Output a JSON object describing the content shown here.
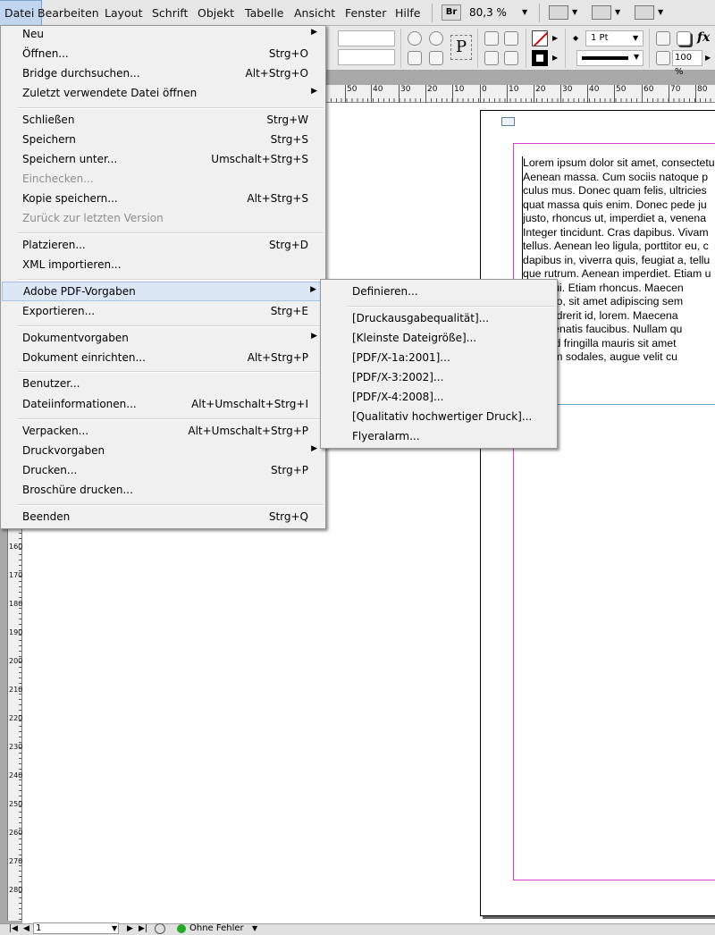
{
  "menubar": {
    "items": [
      "Datei",
      "Bearbeiten",
      "Layout",
      "Schrift",
      "Objekt",
      "Tabelle",
      "Ansicht",
      "Fenster",
      "Hilfe"
    ],
    "bridge_label": "Br",
    "zoom": "80,3 %"
  },
  "control_panel": {
    "stroke_weight": "1 Pt",
    "opacity": "100 %",
    "fx_label": "fx",
    "paragraph_glyph": "P"
  },
  "ruler": {
    "h_labels": [
      "50",
      "40",
      "30",
      "20",
      "10",
      "0",
      "10",
      "20",
      "30",
      "40",
      "50",
      "60",
      "70",
      "80"
    ],
    "v_labels": [
      "160",
      "170",
      "180",
      "190",
      "200",
      "210",
      "220",
      "230",
      "240",
      "250",
      "260",
      "270",
      "280"
    ]
  },
  "document": {
    "body_lines": [
      "Lorem ipsum dolor sit amet, consectetuer",
      "Aenean massa. Cum sociis natoque p",
      "culus mus. Donec quam felis, ultricies",
      "quat massa quis enim. Donec pede ju",
      "justo, rhoncus ut, imperdiet a, venena",
      "Integer tincidunt. Cras dapibus. Vivam",
      "tellus. Aenean leo ligula, porttitor eu, c",
      "dapibus in, viverra quis, feugiat a, tellu",
      "que rutrum. Aenean imperdiet. Etiam u",
      "eget dui. Etiam rhoncus. Maecen",
      "er libero, sit amet adipiscing sem",
      "ar, hendrerit id, lorem. Maecena",
      "ro venenatis faucibus. Nullam qu",
      "eo. Sed fringilla mauris sit amet",
      "bendum sodales, augue velit cu"
    ]
  },
  "file_menu": {
    "items": [
      {
        "label": "Neu",
        "shortcut": "",
        "submenu": true,
        "disabled": false
      },
      {
        "label": "Öffnen...",
        "shortcut": "Strg+O",
        "submenu": false,
        "disabled": false
      },
      {
        "label": "Bridge durchsuchen...",
        "shortcut": "Alt+Strg+O",
        "submenu": false,
        "disabled": false
      },
      {
        "label": "Zuletzt verwendete Datei öffnen",
        "shortcut": "",
        "submenu": true,
        "disabled": false
      },
      {
        "label": "Schließen",
        "shortcut": "Strg+W",
        "submenu": false,
        "disabled": false
      },
      {
        "label": "Speichern",
        "shortcut": "Strg+S",
        "submenu": false,
        "disabled": false
      },
      {
        "label": "Speichern unter...",
        "shortcut": "Umschalt+Strg+S",
        "submenu": false,
        "disabled": false
      },
      {
        "label": "Einchecken...",
        "shortcut": "",
        "submenu": false,
        "disabled": true
      },
      {
        "label": "Kopie speichern...",
        "shortcut": "Alt+Strg+S",
        "submenu": false,
        "disabled": false
      },
      {
        "label": "Zurück zur letzten Version",
        "shortcut": "",
        "submenu": false,
        "disabled": true
      },
      {
        "label": "Platzieren...",
        "shortcut": "Strg+D",
        "submenu": false,
        "disabled": false
      },
      {
        "label": "XML importieren...",
        "shortcut": "",
        "submenu": false,
        "disabled": false
      },
      {
        "label": "Adobe PDF-Vorgaben",
        "shortcut": "",
        "submenu": true,
        "disabled": false
      },
      {
        "label": "Exportieren...",
        "shortcut": "Strg+E",
        "submenu": false,
        "disabled": false
      },
      {
        "label": "Dokumentvorgaben",
        "shortcut": "",
        "submenu": true,
        "disabled": false
      },
      {
        "label": "Dokument einrichten...",
        "shortcut": "Alt+Strg+P",
        "submenu": false,
        "disabled": false
      },
      {
        "label": "Benutzer...",
        "shortcut": "",
        "submenu": false,
        "disabled": false
      },
      {
        "label": "Dateiinformationen...",
        "shortcut": "Alt+Umschalt+Strg+I",
        "submenu": false,
        "disabled": false
      },
      {
        "label": "Verpacken...",
        "shortcut": "Alt+Umschalt+Strg+P",
        "submenu": false,
        "disabled": false
      },
      {
        "label": "Druckvorgaben",
        "shortcut": "",
        "submenu": true,
        "disabled": false
      },
      {
        "label": "Drucken...",
        "shortcut": "Strg+P",
        "submenu": false,
        "disabled": false
      },
      {
        "label": "Broschüre drucken...",
        "shortcut": "",
        "submenu": false,
        "disabled": false
      },
      {
        "label": "Beenden",
        "shortcut": "Strg+Q",
        "submenu": false,
        "disabled": false
      }
    ]
  },
  "pdf_submenu": {
    "items": [
      "Definieren...",
      "[Druckausgabequalität]...",
      "[Kleinste Dateigröße]...",
      "[PDF/X-1a:2001]...",
      "[PDF/X-3:2002]...",
      "[PDF/X-4:2008]...",
      "[Qualitativ hochwertiger Druck]...",
      "Flyeralarm..."
    ]
  },
  "statusbar": {
    "page": "1",
    "preflight": "Ohne Fehler"
  },
  "colors": {
    "margin_guide": "#d040d0",
    "column_guide": "#6aa6c9",
    "menu_highlight": "#dbe7f5",
    "preflight_ok": "#22aa22"
  }
}
